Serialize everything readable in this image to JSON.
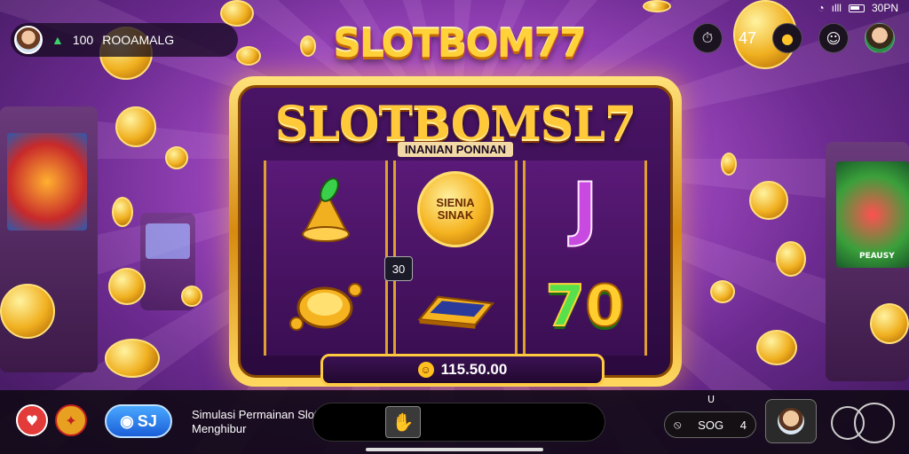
{
  "status_bar": {
    "signal": "ılll",
    "time": "30PN"
  },
  "profile": {
    "prefix": "100",
    "name": "ROOAMALG",
    "arrow": "▲"
  },
  "top_right": {
    "count": "47"
  },
  "logo": {
    "text": "SLOTBOM77"
  },
  "machine": {
    "title": "SLOTBOMSL7",
    "subtitle": "INANIAN PONNAN",
    "reel_badge": "30",
    "coin_badge_line1": "SIENIA",
    "coin_badge_line2": "SINAK",
    "j_symbol": "J",
    "seven_symbol_a": "7",
    "seven_symbol_b": "0",
    "win_amount": "115.50.00"
  },
  "side_signs": {
    "left_sign": "",
    "right_sign": "PEAUSY"
  },
  "bottom": {
    "blue_pill": "SJ",
    "message_line1": "Simulasi Permainan Slot yang",
    "message_line2": "Menghibur",
    "score_prefix": "⦸",
    "score_value": "SOG",
    "score_suffix": "4",
    "u_mark": "U"
  },
  "colors": {
    "accent_gold": "#ffc93a",
    "purple": "#6b2a8f",
    "blue": "#1a5ed8"
  }
}
